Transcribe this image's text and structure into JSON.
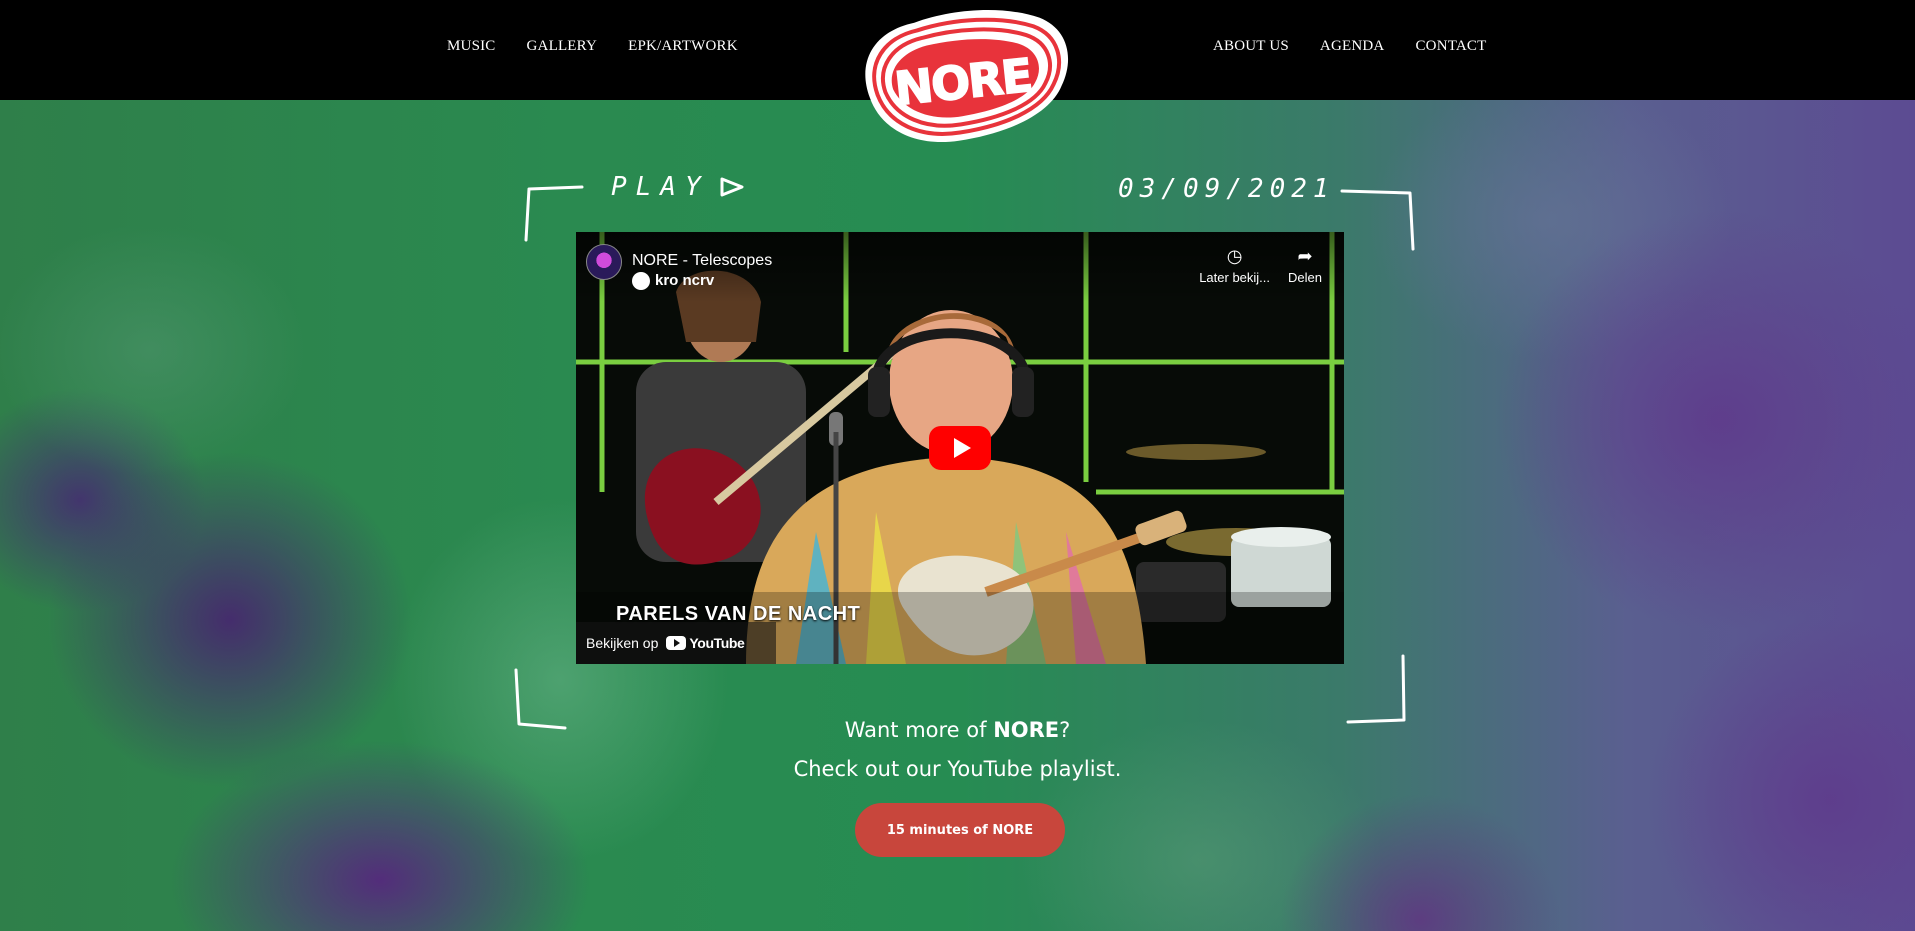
{
  "nav": {
    "left": [
      "MUSIC",
      "GALLERY",
      "EPK/ARTWORK"
    ],
    "right": [
      "ABOUT US",
      "AGENDA",
      "CONTACT"
    ]
  },
  "logo": {
    "text": "NORE",
    "colors": {
      "fill": "#e8333b",
      "outline": "#ffffff"
    }
  },
  "section": {
    "play_label": "PLAY",
    "date": "03/09/2021"
  },
  "video": {
    "title": "NORE - Telescopes",
    "broadcaster": "kro ncrv",
    "actions": [
      {
        "label": "Later bekij...",
        "icon": "clock-icon"
      },
      {
        "label": "Delen",
        "icon": "share-icon"
      }
    ],
    "lower_third": "PARELS VAN DE NACHT",
    "watch_on": "Bekijken op",
    "youtube_brand": "YouTube"
  },
  "promo": {
    "line1_prefix": "Want more of ",
    "line1_bold": "NORE",
    "line1_suffix": "?",
    "line2": "Check out our YouTube playlist.",
    "button_label": "15 minutes of NORE"
  },
  "colors": {
    "header_bg": "#000000",
    "accent_red": "#c8463c",
    "green_bg": "#2a8a50",
    "purple_bg": "#5c4b92"
  }
}
